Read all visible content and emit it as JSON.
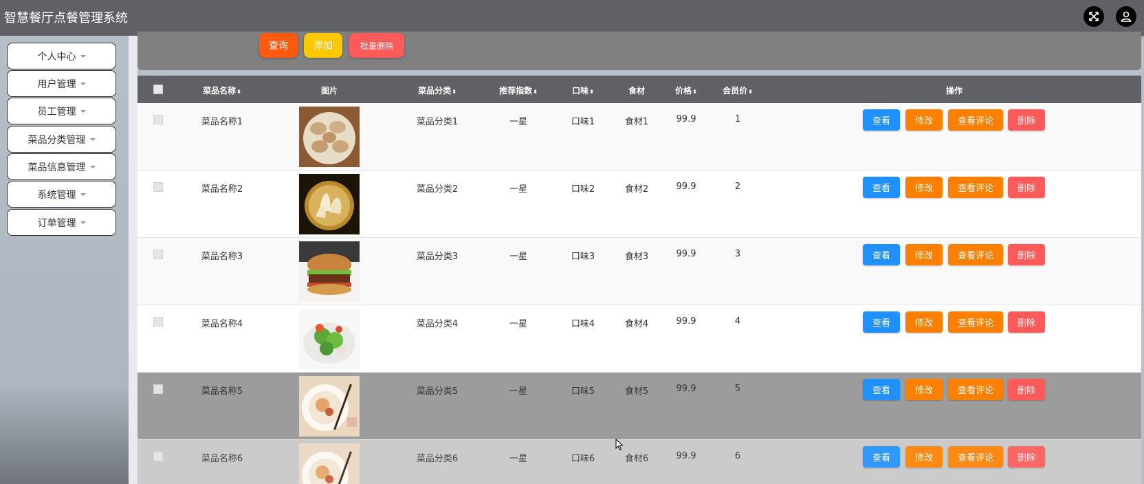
{
  "app": {
    "title": "智慧餐厅点餐管理系统"
  },
  "header_icons": [
    "fullscreen-icon",
    "user-icon"
  ],
  "sidebar": {
    "items": [
      {
        "label": "个人中心"
      },
      {
        "label": "用户管理"
      },
      {
        "label": "员工管理"
      },
      {
        "label": "菜品分类管理"
      },
      {
        "label": "菜品信息管理"
      },
      {
        "label": "系统管理"
      },
      {
        "label": "订单管理"
      }
    ]
  },
  "toolbar": {
    "search_label": "查询",
    "add_label": "添加",
    "batch_delete_label": "批量删除"
  },
  "table": {
    "headers": {
      "name": "菜品名称",
      "image": "图片",
      "category": "菜品分类",
      "rating": "推荐指数",
      "taste": "口味",
      "ingredient": "食材",
      "price": "价格",
      "member_price": "会员价",
      "actions": "操作"
    },
    "actions": {
      "view": "查看",
      "edit": "修改",
      "comments": "查看评论",
      "delete": "删除"
    },
    "rows": [
      {
        "name": "菜品名称1",
        "category": "菜品分类1",
        "rating": "一星",
        "taste": "口味1",
        "ingredient": "食材1",
        "price": "99.9",
        "member_price": "1",
        "image": "dumplings"
      },
      {
        "name": "菜品名称2",
        "category": "菜品分类2",
        "rating": "一星",
        "taste": "口味2",
        "ingredient": "食材2",
        "price": "99.9",
        "member_price": "2",
        "image": "steamed-buns"
      },
      {
        "name": "菜品名称3",
        "category": "菜品分类3",
        "rating": "一星",
        "taste": "口味3",
        "ingredient": "食材3",
        "price": "99.9",
        "member_price": "3",
        "image": "burger"
      },
      {
        "name": "菜品名称4",
        "category": "菜品分类4",
        "rating": "一星",
        "taste": "口味4",
        "ingredient": "食材4",
        "price": "99.9",
        "member_price": "4",
        "image": "salad"
      },
      {
        "name": "菜品名称5",
        "category": "菜品分类5",
        "rating": "一星",
        "taste": "口味5",
        "ingredient": "食材5",
        "price": "99.9",
        "member_price": "5",
        "image": "noodle-bowl"
      },
      {
        "name": "菜品名称6",
        "category": "菜品分类6",
        "rating": "一星",
        "taste": "口味6",
        "ingredient": "食材6",
        "price": "99.9",
        "member_price": "6",
        "image": "noodle-bowl"
      }
    ]
  },
  "colors": {
    "header_bg": "#5f6167",
    "view": "#1e90ff",
    "edit": "#ff8000",
    "delete": "#ff5a5a",
    "search": "#ff5a10",
    "add": "#ffc800"
  }
}
